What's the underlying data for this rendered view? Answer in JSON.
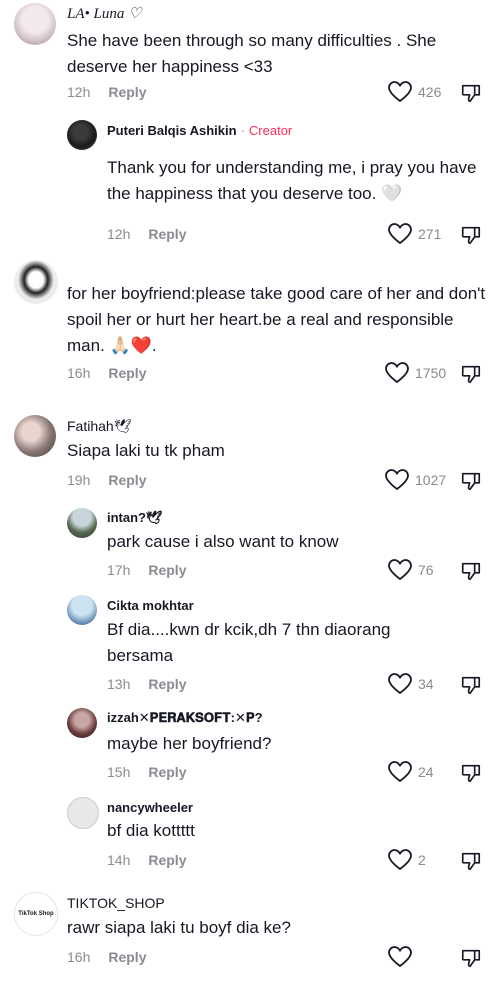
{
  "comments": [
    {
      "user": "LA• Luna ♡",
      "text": "She have been through so many difficulties . She deserve her happiness <33",
      "time": "12h",
      "reply": "Reply",
      "likes": "426"
    },
    {
      "user": "Puteri Balqis Ashikin",
      "badge": "Creator",
      "text": "Thank you for understanding me, i pray you have the happiness that you deserve too. 🤍",
      "time": "12h",
      "reply": "Reply",
      "likes": "271"
    },
    {
      "user": "",
      "text": "for her boyfriend:please take good care of her and don't spoil her or hurt her heart.be a real and responsible man. 🙏🏻❤️.",
      "time": "16h",
      "reply": "Reply",
      "likes": "1750"
    },
    {
      "user": "Fatihah🕊",
      "text": "Siapa laki tu tk pham",
      "time": "19h",
      "reply": "Reply",
      "likes": "1027"
    },
    {
      "user": "intan?🕊",
      "text": "park cause i also want to know",
      "time": "17h",
      "reply": "Reply",
      "likes": "76"
    },
    {
      "user": "Cikta mokhtar",
      "text": "Bf dia....kwn dr kcik,dh 7 thn diaorang bersama",
      "time": "13h",
      "reply": "Reply",
      "likes": "34"
    },
    {
      "user": "izzah✕𝐏𝐄𝐑𝐀𝐊𝐒𝐎𝐅𝐓:✕𝐏?",
      "text": "maybe her boyfriend?",
      "time": "15h",
      "reply": "Reply",
      "likes": "24"
    },
    {
      "user": "nancywheeler",
      "text": "bf dia kottttt",
      "time": "14h",
      "reply": "Reply",
      "likes": "2"
    },
    {
      "user": "TIKTOK_SHOP",
      "avatar_text": "TikTok Shop",
      "text": "rawr siapa laki tu boyf dia ke?",
      "time": "16h",
      "reply": "Reply",
      "likes": ""
    }
  ],
  "colors": {
    "accent": "#fe2c55",
    "muted": "#8a8b91",
    "text": "#161823"
  },
  "icons": {
    "like": "heart-outline-icon",
    "dislike": "thumbs-down-icon"
  }
}
